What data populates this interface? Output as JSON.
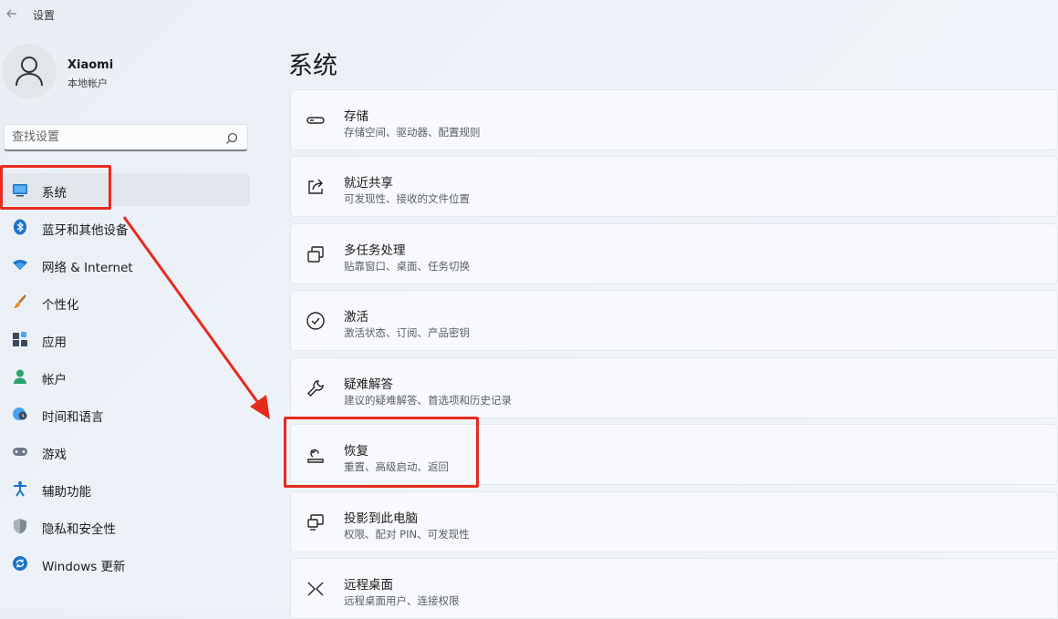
{
  "app": {
    "title": "设置"
  },
  "user": {
    "name": "Xiaomi",
    "account_type": "本地帐户"
  },
  "search": {
    "placeholder": "查找设置"
  },
  "sidebar": {
    "items": [
      {
        "label": "系统",
        "icon": "monitor-icon",
        "active": true
      },
      {
        "label": "蓝牙和其他设备",
        "icon": "bluetooth-icon"
      },
      {
        "label": "网络 & Internet",
        "icon": "wifi-icon"
      },
      {
        "label": "个性化",
        "icon": "brush-icon"
      },
      {
        "label": "应用",
        "icon": "apps-icon"
      },
      {
        "label": "帐户",
        "icon": "person-icon"
      },
      {
        "label": "时间和语言",
        "icon": "globe-clock-icon"
      },
      {
        "label": "游戏",
        "icon": "gamepad-icon"
      },
      {
        "label": "辅助功能",
        "icon": "accessibility-icon"
      },
      {
        "label": "隐私和安全性",
        "icon": "shield-icon"
      },
      {
        "label": "Windows 更新",
        "icon": "update-icon"
      }
    ]
  },
  "main": {
    "title": "系统",
    "cards": [
      {
        "title": "存储",
        "subtitle": "存储空间、驱动器、配置规则",
        "icon": "storage-icon"
      },
      {
        "title": "就近共享",
        "subtitle": "可发现性、接收的文件位置",
        "icon": "share-icon"
      },
      {
        "title": "多任务处理",
        "subtitle": "贴靠窗口、桌面、任务切换",
        "icon": "multitask-icon"
      },
      {
        "title": "激活",
        "subtitle": "激活状态、订阅、产品密钥",
        "icon": "check-circle-icon"
      },
      {
        "title": "疑难解答",
        "subtitle": "建议的疑难解答、首选项和历史记录",
        "icon": "wrench-icon"
      },
      {
        "title": "恢复",
        "subtitle": "重置、高级启动、返回",
        "icon": "recovery-icon"
      },
      {
        "title": "投影到此电脑",
        "subtitle": "权限、配对 PIN、可发现性",
        "icon": "project-icon"
      },
      {
        "title": "远程桌面",
        "subtitle": "远程桌面用户、连接权限",
        "icon": "remote-desktop-icon"
      }
    ]
  },
  "colors": {
    "accent": "#0067c0",
    "annotation": "#e62b1e"
  }
}
